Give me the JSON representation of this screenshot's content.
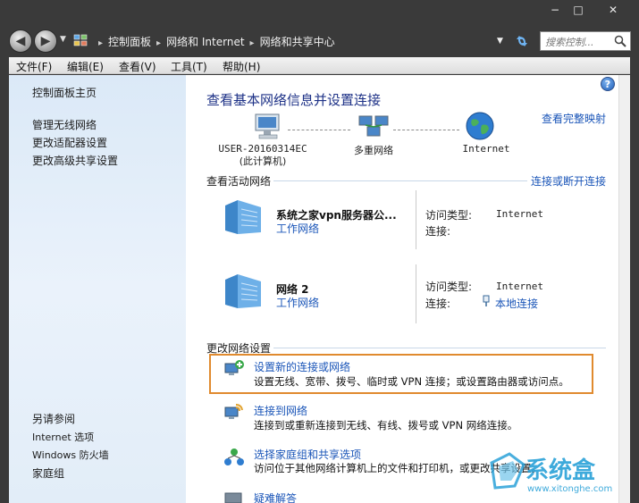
{
  "window": {
    "minimize": "−",
    "maximize": "□",
    "close": "✕"
  },
  "address": {
    "breadcrumbs": [
      "控制面板",
      "网络和 Internet",
      "网络和共享中心"
    ],
    "search_placeholder": "搜索控制...",
    "icons": [
      "back-arrow-icon",
      "forward-arrow-icon",
      "control-panel-icon",
      "refresh-icon",
      "search-icon"
    ]
  },
  "menu": [
    "文件(F)",
    "编辑(E)",
    "查看(V)",
    "工具(T)",
    "帮助(H)"
  ],
  "left_pane": {
    "top_links": [
      "控制面板主页",
      "管理无线网络",
      "更改适配器设置",
      "更改高级共享设置"
    ],
    "see_also_title": "另请参阅",
    "see_also_links": [
      "Internet 选项",
      "Windows 防火墙",
      "家庭组"
    ]
  },
  "main": {
    "title": "查看基本网络信息并设置连接",
    "full_map_link": "查看完整映射",
    "map": {
      "computer_line1": "USER-20160314EC",
      "computer_line2": "(此计算机)",
      "network": "多重网络",
      "internet": "Internet"
    },
    "active_networks_title": "查看活动网络",
    "connect_link": "连接或断开连接",
    "networks": [
      {
        "name": "系统之家vpn服务器公...",
        "type": "工作网络",
        "access_label": "访问类型:",
        "access_value": "Internet",
        "connection_label": "连接:",
        "connection_value": ""
      },
      {
        "name": "网络  2",
        "type": "工作网络",
        "access_label": "访问类型:",
        "access_value": "Internet",
        "connection_label": "连接:",
        "connection_value": "本地连接"
      }
    ],
    "change_settings_title": "更改网络设置",
    "tasks": [
      {
        "title": "设置新的连接或网络",
        "desc": "设置无线、宽带、拨号、临时或 VPN 连接；或设置路由器或访问点。"
      },
      {
        "title": "连接到网络",
        "desc": "连接到或重新连接到无线、有线、拨号或 VPN 网络连接。"
      },
      {
        "title": "选择家庭组和共享选项",
        "desc": "访问位于其他网络计算机上的文件和打印机，或更改共享设置。"
      },
      {
        "title": "疑难解答",
        "desc": ""
      }
    ]
  },
  "watermark": {
    "text": "系统盒",
    "url": "www.xitonghe.com"
  }
}
